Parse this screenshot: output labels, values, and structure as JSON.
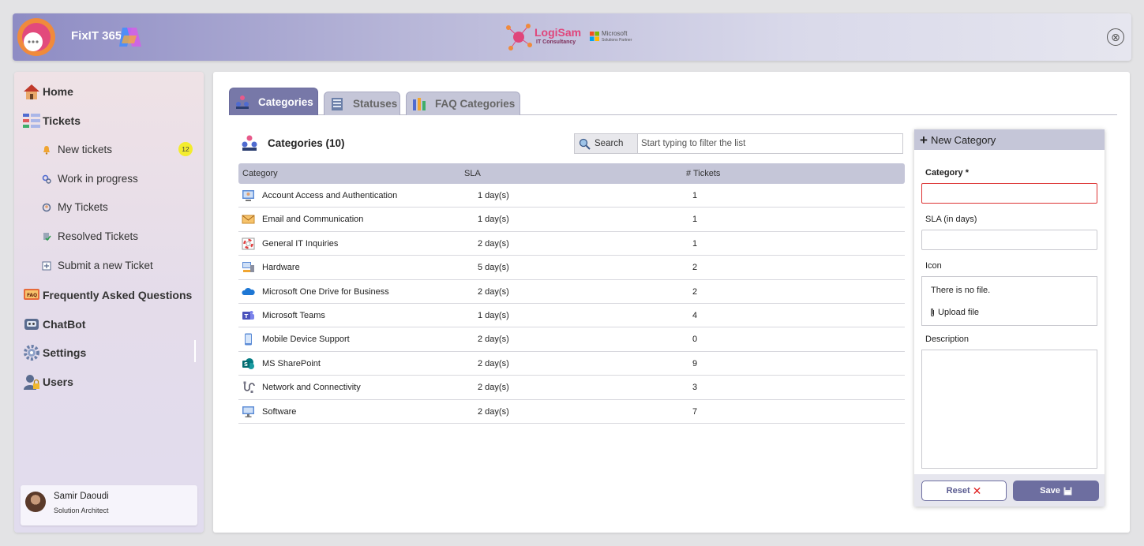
{
  "header": {
    "app_title": "FixIT 365",
    "brand_name": "LogiSam",
    "brand_sub": "IT Consultancy",
    "partner_name": "Microsoft",
    "partner_sub": "Solutions Partner",
    "close_icon": "⊗"
  },
  "sidebar": {
    "home": "Home",
    "tickets": "Tickets",
    "sub_items": [
      {
        "label": "New tickets",
        "badge": "12",
        "icon": "bell-icon"
      },
      {
        "label": "Work in progress",
        "icon": "gears-icon"
      },
      {
        "label": "My Tickets",
        "icon": "user-gear-icon"
      },
      {
        "label": "Resolved Tickets",
        "icon": "check-doc-icon"
      },
      {
        "label": "Submit a new Ticket",
        "icon": "plus-box-icon"
      }
    ],
    "faq": "Frequently Asked Questions",
    "chatbot": "ChatBot",
    "settings": "Settings",
    "users": "Users"
  },
  "profile": {
    "name": "Samir Daoudi",
    "role": "Solution Architect"
  },
  "tabs": [
    {
      "label": "Categories",
      "active": true
    },
    {
      "label": "Statuses",
      "active": false
    },
    {
      "label": "FAQ Categories",
      "active": false
    }
  ],
  "list": {
    "title": "Categories (10)",
    "search_label": "Search",
    "search_placeholder": "Start typing to filter the list",
    "columns": [
      "Category",
      "SLA",
      "# Tickets"
    ],
    "rows": [
      {
        "name": "Account Access and Authentication",
        "sla": "1 day(s)",
        "tickets": "1",
        "icon": "user-login-icon"
      },
      {
        "name": "Email and Communication",
        "sla": "1 day(s)",
        "tickets": "1",
        "icon": "envelope-icon"
      },
      {
        "name": "General IT Inquiries",
        "sla": "2 day(s)",
        "tickets": "1",
        "icon": "lifebuoy-icon"
      },
      {
        "name": "Hardware",
        "sla": "5 day(s)",
        "tickets": "2",
        "icon": "computer-icon"
      },
      {
        "name": "Microsoft One Drive for Business",
        "sla": "2 day(s)",
        "tickets": "2",
        "icon": "onedrive-icon"
      },
      {
        "name": "Microsoft Teams",
        "sla": "1 day(s)",
        "tickets": "4",
        "icon": "teams-icon"
      },
      {
        "name": "Mobile Device Support",
        "sla": "2 day(s)",
        "tickets": "0",
        "icon": "phone-icon"
      },
      {
        "name": "MS SharePoint",
        "sla": "2 day(s)",
        "tickets": "9",
        "icon": "sharepoint-icon"
      },
      {
        "name": "Network and Connectivity",
        "sla": "2 day(s)",
        "tickets": "3",
        "icon": "cable-icon"
      },
      {
        "name": "Software",
        "sla": "2 day(s)",
        "tickets": "7",
        "icon": "monitor-icon"
      }
    ]
  },
  "form": {
    "title": "New Category",
    "category_label": "Category *",
    "category_value": "",
    "sla_label": "SLA (in days)",
    "sla_value": "",
    "icon_label": "Icon",
    "no_file": "There is no file.",
    "upload_label": "Upload file",
    "description_label": "Description",
    "description_value": "",
    "reset_label": "Reset",
    "save_label": "Save"
  },
  "colors": {
    "accent": "#6d6ea0",
    "tab_active": "#7778a8",
    "table_header": "#c5c6d8",
    "badge": "#f3ec2d",
    "error": "#dd3333"
  }
}
